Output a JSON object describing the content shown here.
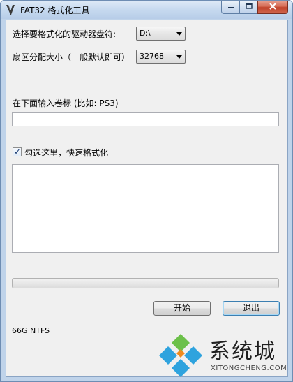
{
  "window": {
    "title": "FAT32 格式化工具",
    "icon": "fat32-app-icon"
  },
  "form": {
    "drive_label": "选择要格式化的驱动器盘符:",
    "drive_value": "D:\\",
    "cluster_label": "扇区分配大小（一般默认即可）",
    "cluster_value": "32768",
    "volume_label_prompt": "在下面输入卷标 (比如: PS3)",
    "volume_label_value": "",
    "quick_format_label": "勾选这里，快速格式化",
    "quick_format_checked": true,
    "log_text": "",
    "progress": 0
  },
  "buttons": {
    "start": "开始",
    "exit": "退出"
  },
  "status": {
    "disk_info": "66G NTFS"
  },
  "watermark": {
    "title": "系统城",
    "subtitle": "XITONGCHENG.COM",
    "colors": [
      "#2fa3de",
      "#6cc04a",
      "#f08a1d"
    ]
  }
}
